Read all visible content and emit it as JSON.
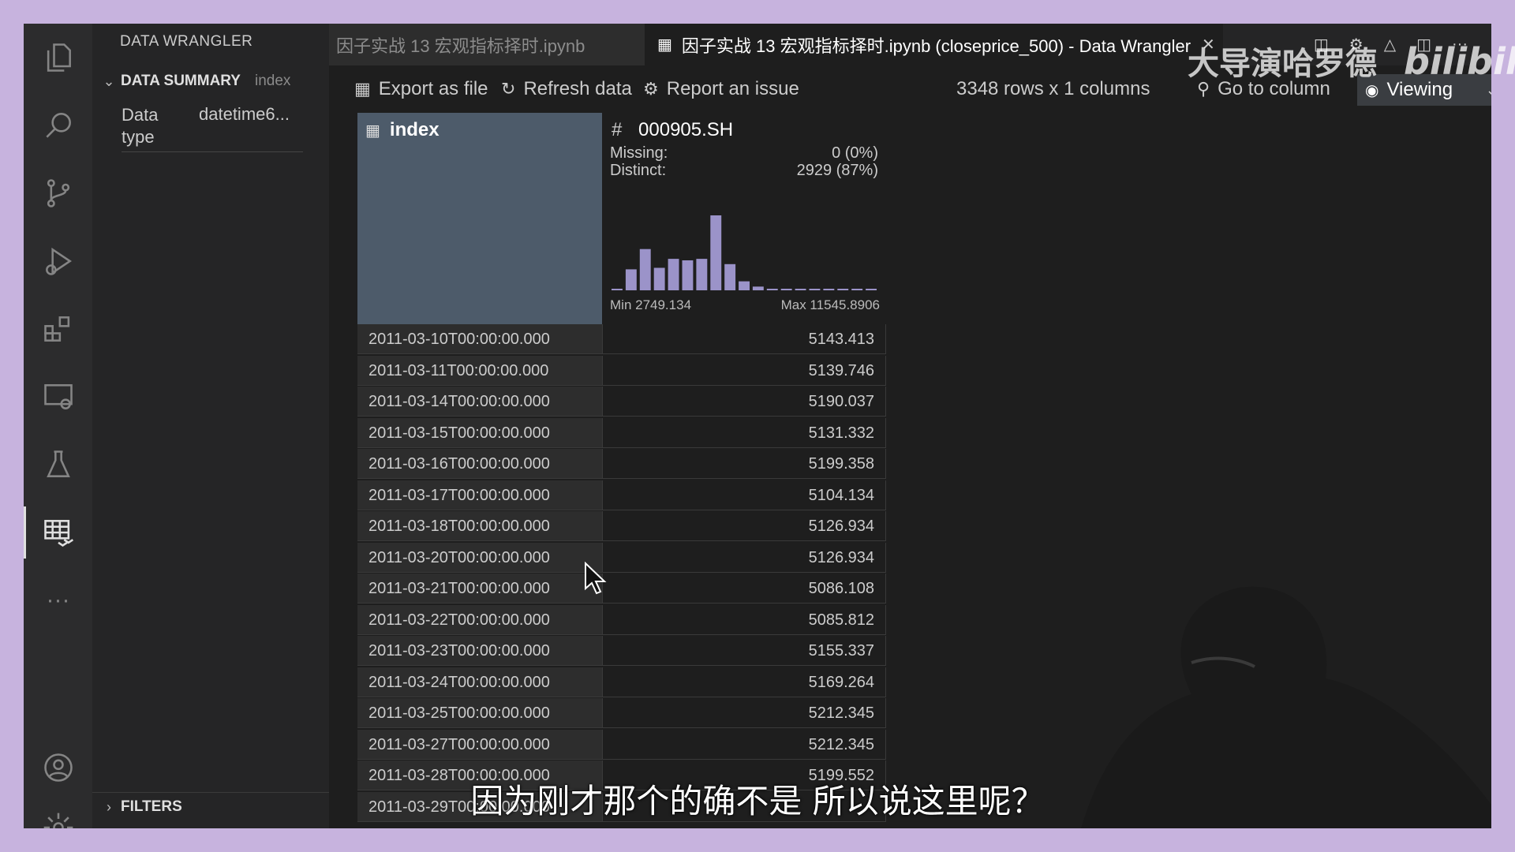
{
  "sidebar": {
    "title": "DATA WRANGLER",
    "summary_title": "DATA SUMMARY",
    "summary_sub": "index",
    "data_type_label": "Data type",
    "data_type_value": "datetime6...",
    "filters_title": "FILTERS"
  },
  "tabs": {
    "inactive": "因子实战 13 宏观指标择时.ipynb",
    "active": "因子实战 13 宏观指标择时.ipynb (closeprice_500) - Data Wrangler"
  },
  "toolbar": {
    "export": "Export as file",
    "refresh": "Refresh data",
    "report": "Report an issue",
    "rows_cols": "3348 rows x 1 columns",
    "goto": "Go to column",
    "viewing": "Viewing"
  },
  "grid": {
    "index_header": "index",
    "column_header": "000905.SH",
    "missing_label": "Missing:",
    "missing_value": "0 (0%)",
    "distinct_label": "Distinct:",
    "distinct_value": "2929 (87%)",
    "hist_min": "Min 2749.134",
    "hist_max": "Max 11545.8906",
    "histogram": [
      0.02,
      0.28,
      0.55,
      0.3,
      0.42,
      0.4,
      0.42,
      1.0,
      0.35,
      0.12,
      0.05,
      0.02,
      0.02,
      0.02,
      0.02,
      0.02,
      0.02,
      0.02,
      0.02
    ],
    "rows": [
      {
        "index": "2011-03-10T00:00:00.000",
        "value": "5143.413"
      },
      {
        "index": "2011-03-11T00:00:00.000",
        "value": "5139.746"
      },
      {
        "index": "2011-03-14T00:00:00.000",
        "value": "5190.037"
      },
      {
        "index": "2011-03-15T00:00:00.000",
        "value": "5131.332"
      },
      {
        "index": "2011-03-16T00:00:00.000",
        "value": "5199.358"
      },
      {
        "index": "2011-03-17T00:00:00.000",
        "value": "5104.134"
      },
      {
        "index": "2011-03-18T00:00:00.000",
        "value": "5126.934"
      },
      {
        "index": "2011-03-20T00:00:00.000",
        "value": "5126.934"
      },
      {
        "index": "2011-03-21T00:00:00.000",
        "value": "5086.108"
      },
      {
        "index": "2011-03-22T00:00:00.000",
        "value": "5085.812"
      },
      {
        "index": "2011-03-23T00:00:00.000",
        "value": "5155.337"
      },
      {
        "index": "2011-03-24T00:00:00.000",
        "value": "5169.264"
      },
      {
        "index": "2011-03-25T00:00:00.000",
        "value": "5212.345"
      },
      {
        "index": "2011-03-27T00:00:00.000",
        "value": "5212.345"
      },
      {
        "index": "2011-03-28T00:00:00.000",
        "value": "5199.552"
      },
      {
        "index": "2011-03-29T00:00:00.000",
        "value": ""
      }
    ]
  },
  "overlay": {
    "subtitle": "因为刚才那个的确不是 所以说这里呢？",
    "watermark_name": "大导演哈罗德",
    "watermark_logo": "bilibili"
  },
  "icons": [
    "files-icon",
    "search-icon",
    "source-control-icon",
    "run-debug-icon",
    "extensions-icon",
    "remote-explorer-icon",
    "testing-icon",
    "data-wrangler-icon",
    "more-icon",
    "account-icon",
    "settings-icon"
  ]
}
